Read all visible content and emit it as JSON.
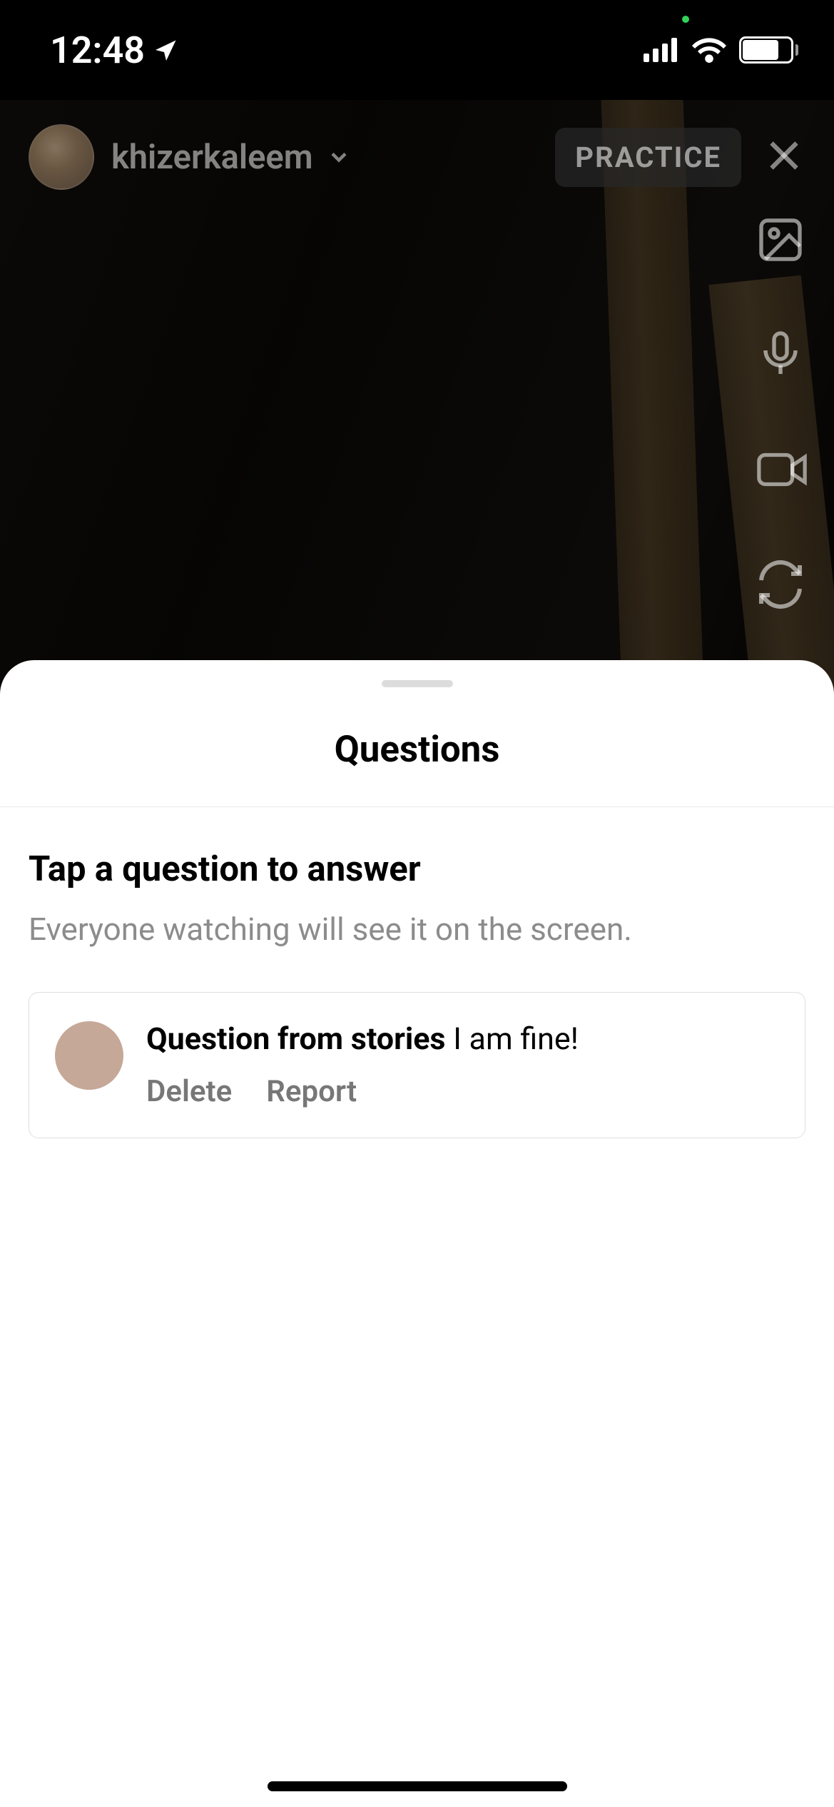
{
  "status": {
    "time": "12:48",
    "battery": "71"
  },
  "live": {
    "username": "khizerkaleem",
    "practice_label": "PRACTICE"
  },
  "sheet": {
    "title": "Questions",
    "heading": "Tap a question to answer",
    "subheading": "Everyone watching will see it on the screen."
  },
  "question": {
    "source": "Question from stories",
    "text": "I am fine!",
    "delete_label": "Delete",
    "report_label": "Report"
  }
}
